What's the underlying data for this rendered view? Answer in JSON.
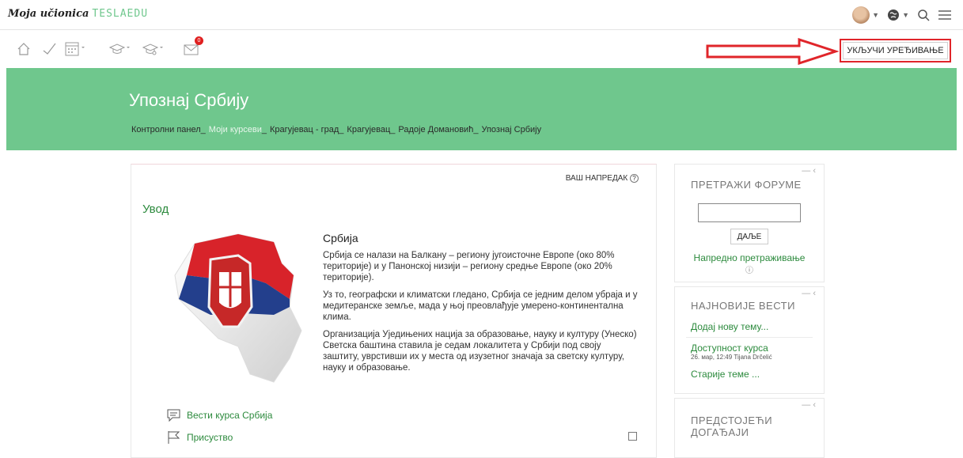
{
  "topbar": {
    "brand": "Moja učionica",
    "brand_suffix": "TESLAEDU",
    "globe_icon": "globe-icon",
    "search_icon": "search-icon",
    "menu_icon": "hamburger-icon"
  },
  "toolbar": {
    "icons": [
      "home-icon",
      "check-icon",
      "calendar-icon",
      "graduation-cap-icon",
      "graduation-cap-settings-icon",
      "envelope-icon"
    ],
    "message_count": "0",
    "edit_button": "УКЉУЧИ УРЕЂИВАЊЕ"
  },
  "hero": {
    "title": "Упознај Србију",
    "breadcrumb": [
      "Контролни панел",
      "Моји курсеви",
      "Крагујевац - град",
      "Крагујевац",
      "Радоје Домановић",
      "Упознај Србију"
    ]
  },
  "course": {
    "progress_label": "ВАШ НАПРЕДАК",
    "section_title": "Увод",
    "summary_title": "Србија",
    "paragraphs": [
      "Србија се налази на Балкану – региону југоисточне Европе (око 80% територије) и у Панонској низији – региону средње Европе (око 20% територије).",
      "Уз то, географски и климатски гледано, Србија се једним делом убраја и у медитеранске земље, мада у њој преовлађује умерено-континентална клима.",
      "Организација Уједињених нација за образовање, науку и културу (Унеско) Светска баштина ставила је седам локалитета у Србији под своју заштиту, уврстивши их у места од изузетног значаја за светску културу, науку и образовање."
    ],
    "activities": [
      {
        "label": "Вести курса Србија",
        "icon": "forum-icon"
      },
      {
        "label": "Присуство",
        "icon": "flag-icon"
      }
    ]
  },
  "blocks": {
    "search_forums": {
      "title": "ПРЕТРАЖИ ФОРУМЕ",
      "button": "ДАЉЕ",
      "advanced": "Напредно претраживање"
    },
    "latest_news": {
      "title": "НАЈНОВИЈЕ ВЕСТИ",
      "add_topic": "Додај нову тему...",
      "item_title": "Доступност курса",
      "item_meta": "26. мар, 12:49  Tijana Drčelić",
      "older": "Старије теме ..."
    },
    "upcoming": {
      "title": "ПРЕДСТОЈЕЋИ ДОГАЂАЈИ"
    }
  },
  "colors": {
    "accent": "#6fc78d",
    "link": "#2c8a3d",
    "annotation_red": "#e0252a",
    "badge": "#e02020"
  }
}
